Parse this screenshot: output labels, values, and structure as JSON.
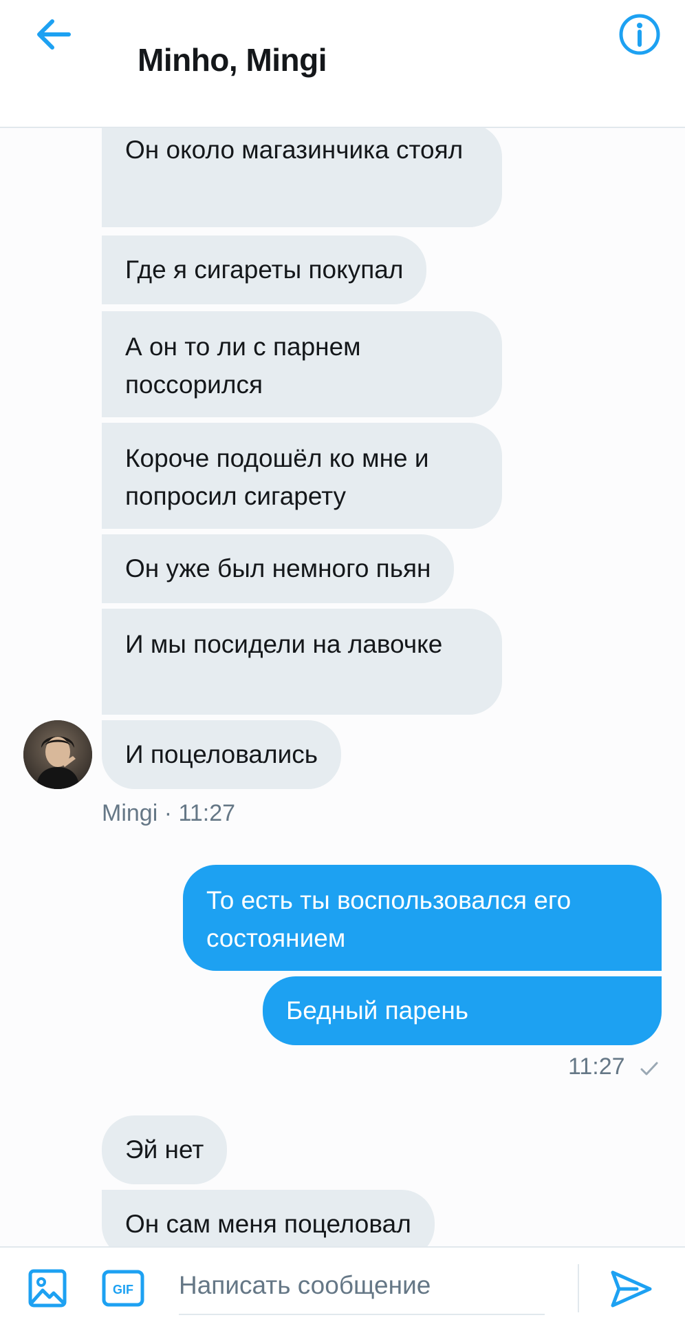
{
  "header": {
    "title": "Minho, Mingi",
    "back_icon": "arrow-left-icon",
    "info_icon": "info-icon"
  },
  "colors": {
    "accent": "#1da1f2",
    "incoming_bubble": "#e6ecf0",
    "meta_text": "#657786"
  },
  "messages": [
    {
      "direction": "in",
      "text": "Он около магазинчика стоял"
    },
    {
      "direction": "in",
      "text": "Где я сигареты покупал"
    },
    {
      "direction": "in",
      "text": "А он то ли с парнем поссорился"
    },
    {
      "direction": "in",
      "text": "Короче подошёл ко мне и попросил сигарету"
    },
    {
      "direction": "in",
      "text": "Он уже был немного пьян"
    },
    {
      "direction": "in",
      "text": "И мы посидели на лавочке"
    },
    {
      "direction": "in",
      "text": "И поцеловались"
    },
    {
      "direction": "out",
      "text": "То есть ты воспользовался его состоянием"
    },
    {
      "direction": "out",
      "text": "Бедный парень"
    },
    {
      "direction": "in",
      "text": "Эй нет"
    },
    {
      "direction": "in",
      "text": "Он сам меня поцеловал"
    }
  ],
  "meta": {
    "incoming_sender_time": "Mingi · 11:27",
    "outgoing_time": "11:27",
    "read_icon": "check-icon"
  },
  "composer": {
    "placeholder": "Написать сообщение",
    "image_icon": "image-icon",
    "gif_label": "GIF",
    "send_icon": "send-icon"
  }
}
